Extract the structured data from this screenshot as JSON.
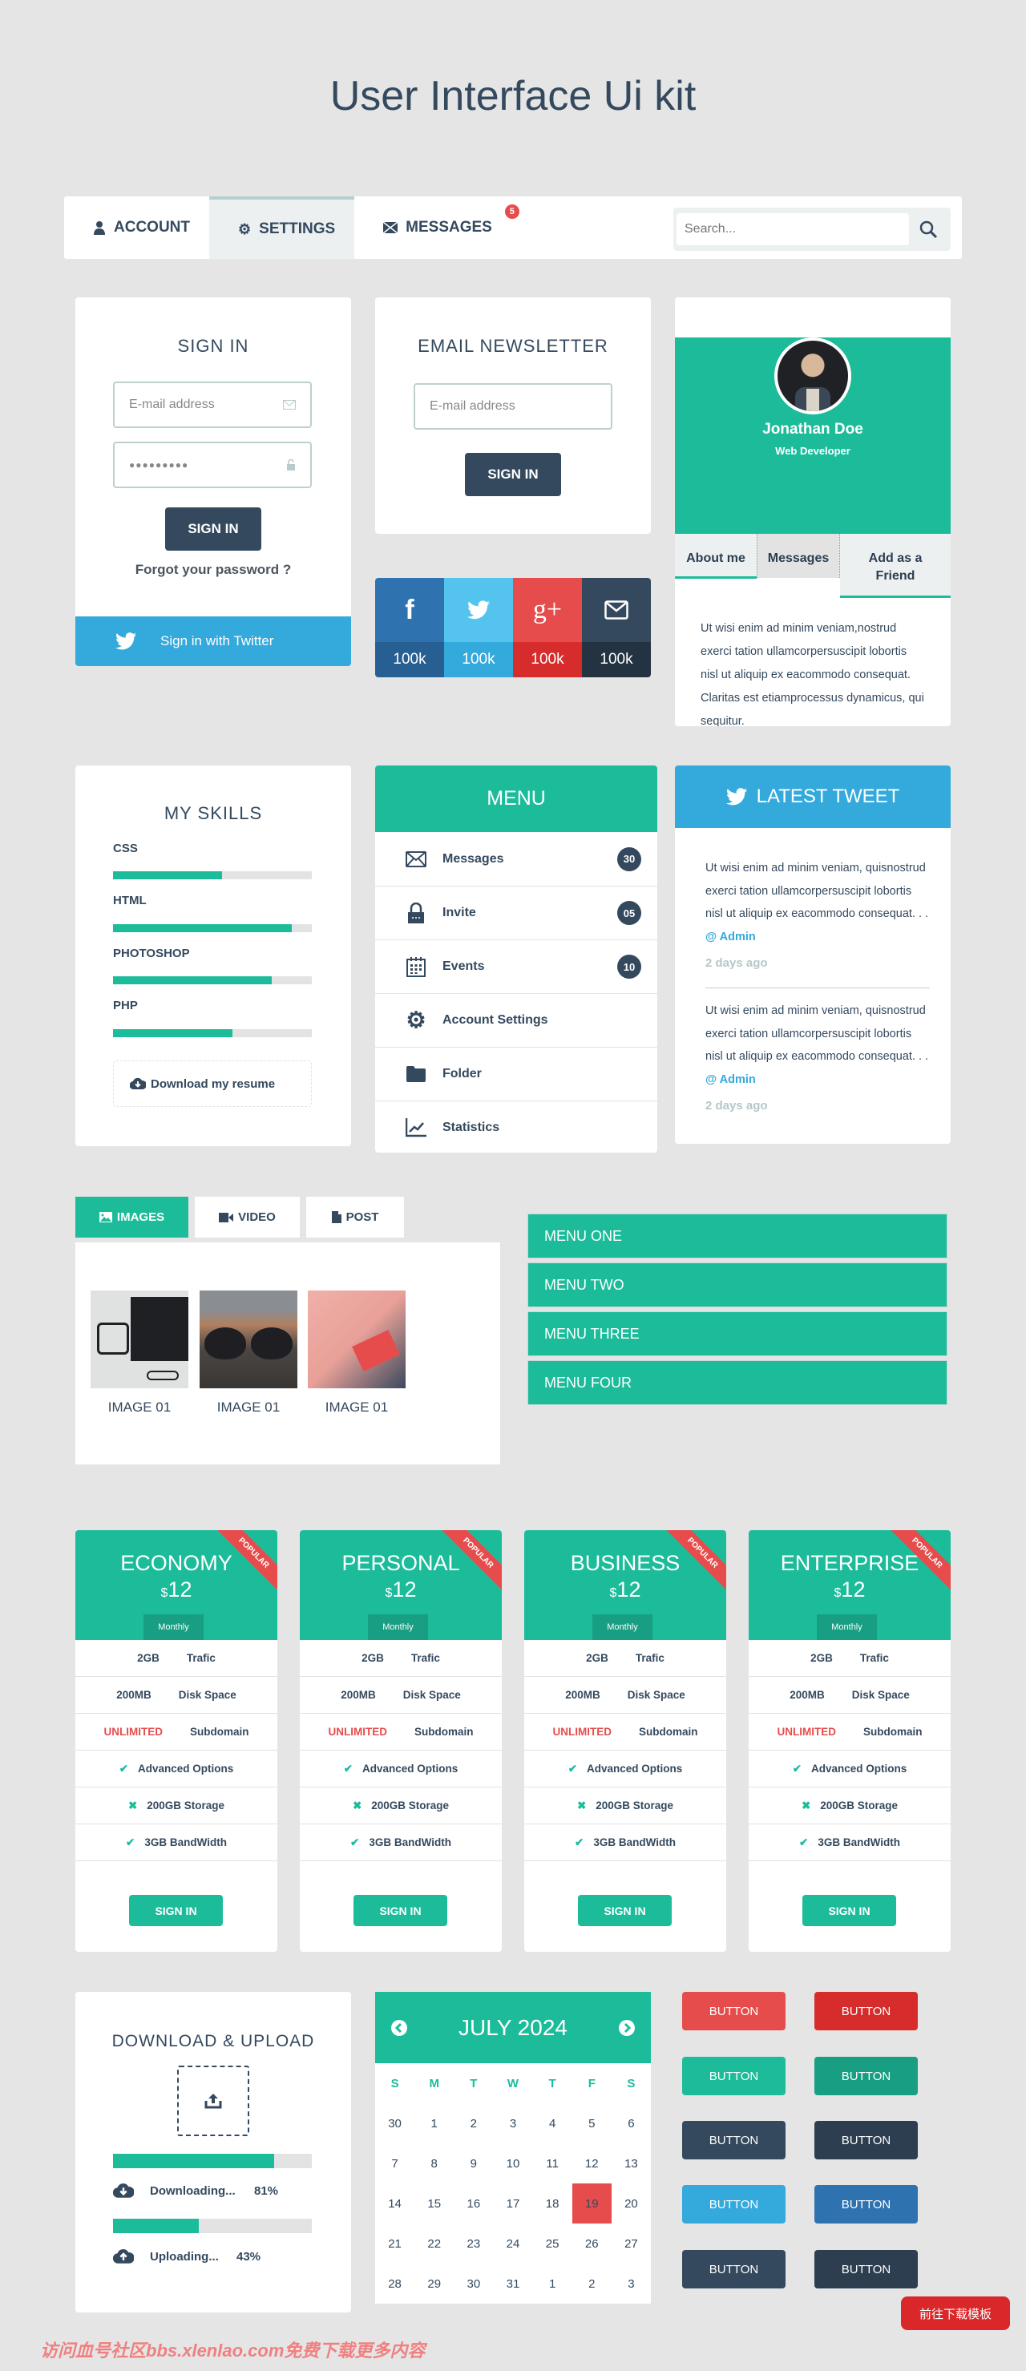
{
  "page_title": "User Interface Ui kit",
  "nav": {
    "items": [
      {
        "label": "ACCOUNT",
        "icon": "user-icon"
      },
      {
        "label": "SETTINGS",
        "icon": "gear-icon",
        "active": true
      },
      {
        "label": "MESSAGES",
        "icon": "envelope-icon",
        "badge": "5"
      }
    ],
    "search_placeholder": "Search..."
  },
  "signin": {
    "title": "SIGN IN",
    "email_placeholder": "E-mail address",
    "password_value": "●●●●●●●●●",
    "button": "SIGN IN",
    "forgot": "Forgot your password ?",
    "twitter": "Sign in with Twitter"
  },
  "newsletter": {
    "title": "EMAIL NEWSLETTER",
    "email_placeholder": "E-mail address",
    "button": "SIGN IN"
  },
  "social": [
    {
      "network": "facebook",
      "glyph": "f",
      "count": "100k",
      "color": "#2f72b0",
      "dark": "#285f93"
    },
    {
      "network": "twitter",
      "glyph": "",
      "count": "100k",
      "color": "#54c4ef",
      "dark": "#34a9dc"
    },
    {
      "network": "google-plus",
      "glyph": "g+",
      "count": "100k",
      "color": "#e74c4c",
      "dark": "#d62c2c"
    },
    {
      "network": "email",
      "glyph": "",
      "count": "100k",
      "color": "#34495e",
      "dark": "#243342"
    }
  ],
  "profile": {
    "name": "Jonathan Doe",
    "role": "Web Developer",
    "tabs": [
      "About me",
      "Messages",
      "Add as a Friend"
    ],
    "bio": "Ut wisi enim ad minim veniam,nostrud exerci tation ullamcorpersuscipit lobortis nisl ut aliquip ex eacommodo consequat. Claritas est etiamprocessus dynamicus, qui sequitur."
  },
  "skills": {
    "title": "MY SKILLS",
    "items": [
      {
        "name": "CSS",
        "percent": 55
      },
      {
        "name": "HTML",
        "percent": 90
      },
      {
        "name": "PHOTOSHOP",
        "percent": 80
      },
      {
        "name": "PHP",
        "percent": 60
      }
    ],
    "download": "Download my resume"
  },
  "menu": {
    "title": "MENU",
    "items": [
      {
        "label": "Messages",
        "icon": "envelope-icon",
        "count": "30"
      },
      {
        "label": "Invite",
        "icon": "lock-icon",
        "count": "05"
      },
      {
        "label": "Events",
        "icon": "calendar-icon",
        "count": "10"
      },
      {
        "label": "Account Settings",
        "icon": "gear-icon"
      },
      {
        "label": "Folder",
        "icon": "folder-icon"
      },
      {
        "label": "Statistics",
        "icon": "chart-icon"
      }
    ]
  },
  "tweet": {
    "title": "LATEST TWEET",
    "items": [
      {
        "text": "Ut wisi enim ad minim veniam, quisnostrud exerci tation ullamcorpersuscipit lobortis nisl ut aliquip ex eacommodo consequat. . . ",
        "author": "@ Admin",
        "time": "2 days ago"
      },
      {
        "text": "Ut wisi enim ad minim veniam, quisnostrud exerci tation ullamcorpersuscipit lobortis nisl ut aliquip ex eacommodo consequat. . . ",
        "author": "@ Admin",
        "time": "2 days ago"
      }
    ]
  },
  "gallery": {
    "tabs": [
      {
        "label": "IMAGES",
        "icon": "image-icon",
        "active": true
      },
      {
        "label": "VIDEO",
        "icon": "video-icon"
      },
      {
        "label": "POST",
        "icon": "document-icon"
      }
    ],
    "images": [
      {
        "caption": "IMAGE 01",
        "subject": "laptop-camera"
      },
      {
        "caption": "IMAGE 01",
        "subject": "sunglasses"
      },
      {
        "caption": "IMAGE 01",
        "subject": "notebook"
      }
    ]
  },
  "accordion": [
    "MENU ONE",
    "MENU TWO",
    "MENU THREE",
    "MENU FOUR"
  ],
  "pricing": {
    "ribbon": "POPULAR",
    "period": "Monthly",
    "currency": "$",
    "button": "SIGN IN",
    "plans": [
      {
        "name": "ECONOMY",
        "price": "12"
      },
      {
        "name": "PERSONAL",
        "price": "12"
      },
      {
        "name": "BUSINESS",
        "price": "12"
      },
      {
        "name": "ENTERPRISE",
        "price": "12"
      }
    ],
    "features": [
      {
        "a": "2GB",
        "b": "Trafic"
      },
      {
        "a": "200MB",
        "b": "Disk Space"
      },
      {
        "a": "UNLIMITED",
        "b": "Subdomain",
        "highlight": true
      },
      {
        "mark": "check",
        "b": "Advanced Options"
      },
      {
        "mark": "cross",
        "b": "200GB Storage"
      },
      {
        "mark": "check",
        "b": "3GB BandWidth"
      }
    ]
  },
  "transfer": {
    "title": "DOWNLOAD & UPLOAD",
    "download_label": "Downloading...",
    "download_percent": 81,
    "download_text": "81%",
    "upload_label": "Uploading...",
    "upload_percent": 43,
    "upload_text": "43%"
  },
  "calendar": {
    "month": "JULY 2024",
    "weekdays": [
      "S",
      "M",
      "T",
      "W",
      "T",
      "F",
      "S"
    ],
    "days": [
      "30",
      "1",
      "2",
      "3",
      "4",
      "5",
      "6",
      "7",
      "8",
      "9",
      "10",
      "11",
      "12",
      "13",
      "14",
      "15",
      "16",
      "17",
      "18",
      "19",
      "20",
      "21",
      "22",
      "23",
      "24",
      "25",
      "26",
      "27",
      "28",
      "29",
      "30",
      "31",
      "1",
      "2",
      "3"
    ],
    "selected": "19"
  },
  "buttons": {
    "label": "BUTTON",
    "rows": [
      [
        "#e74c4c",
        "#d62c2c"
      ],
      [
        "#1cbc9b",
        "#179e83"
      ],
      [
        "#34495e",
        "#2c3e50"
      ],
      [
        "#34a9dc",
        "#2f72b0"
      ],
      [
        "#34495e",
        "#2c3e50"
      ]
    ]
  },
  "download_template": "前往下载模板",
  "watermark": "访问血号社区bbs.xlenlao.com免费下载更多内容"
}
